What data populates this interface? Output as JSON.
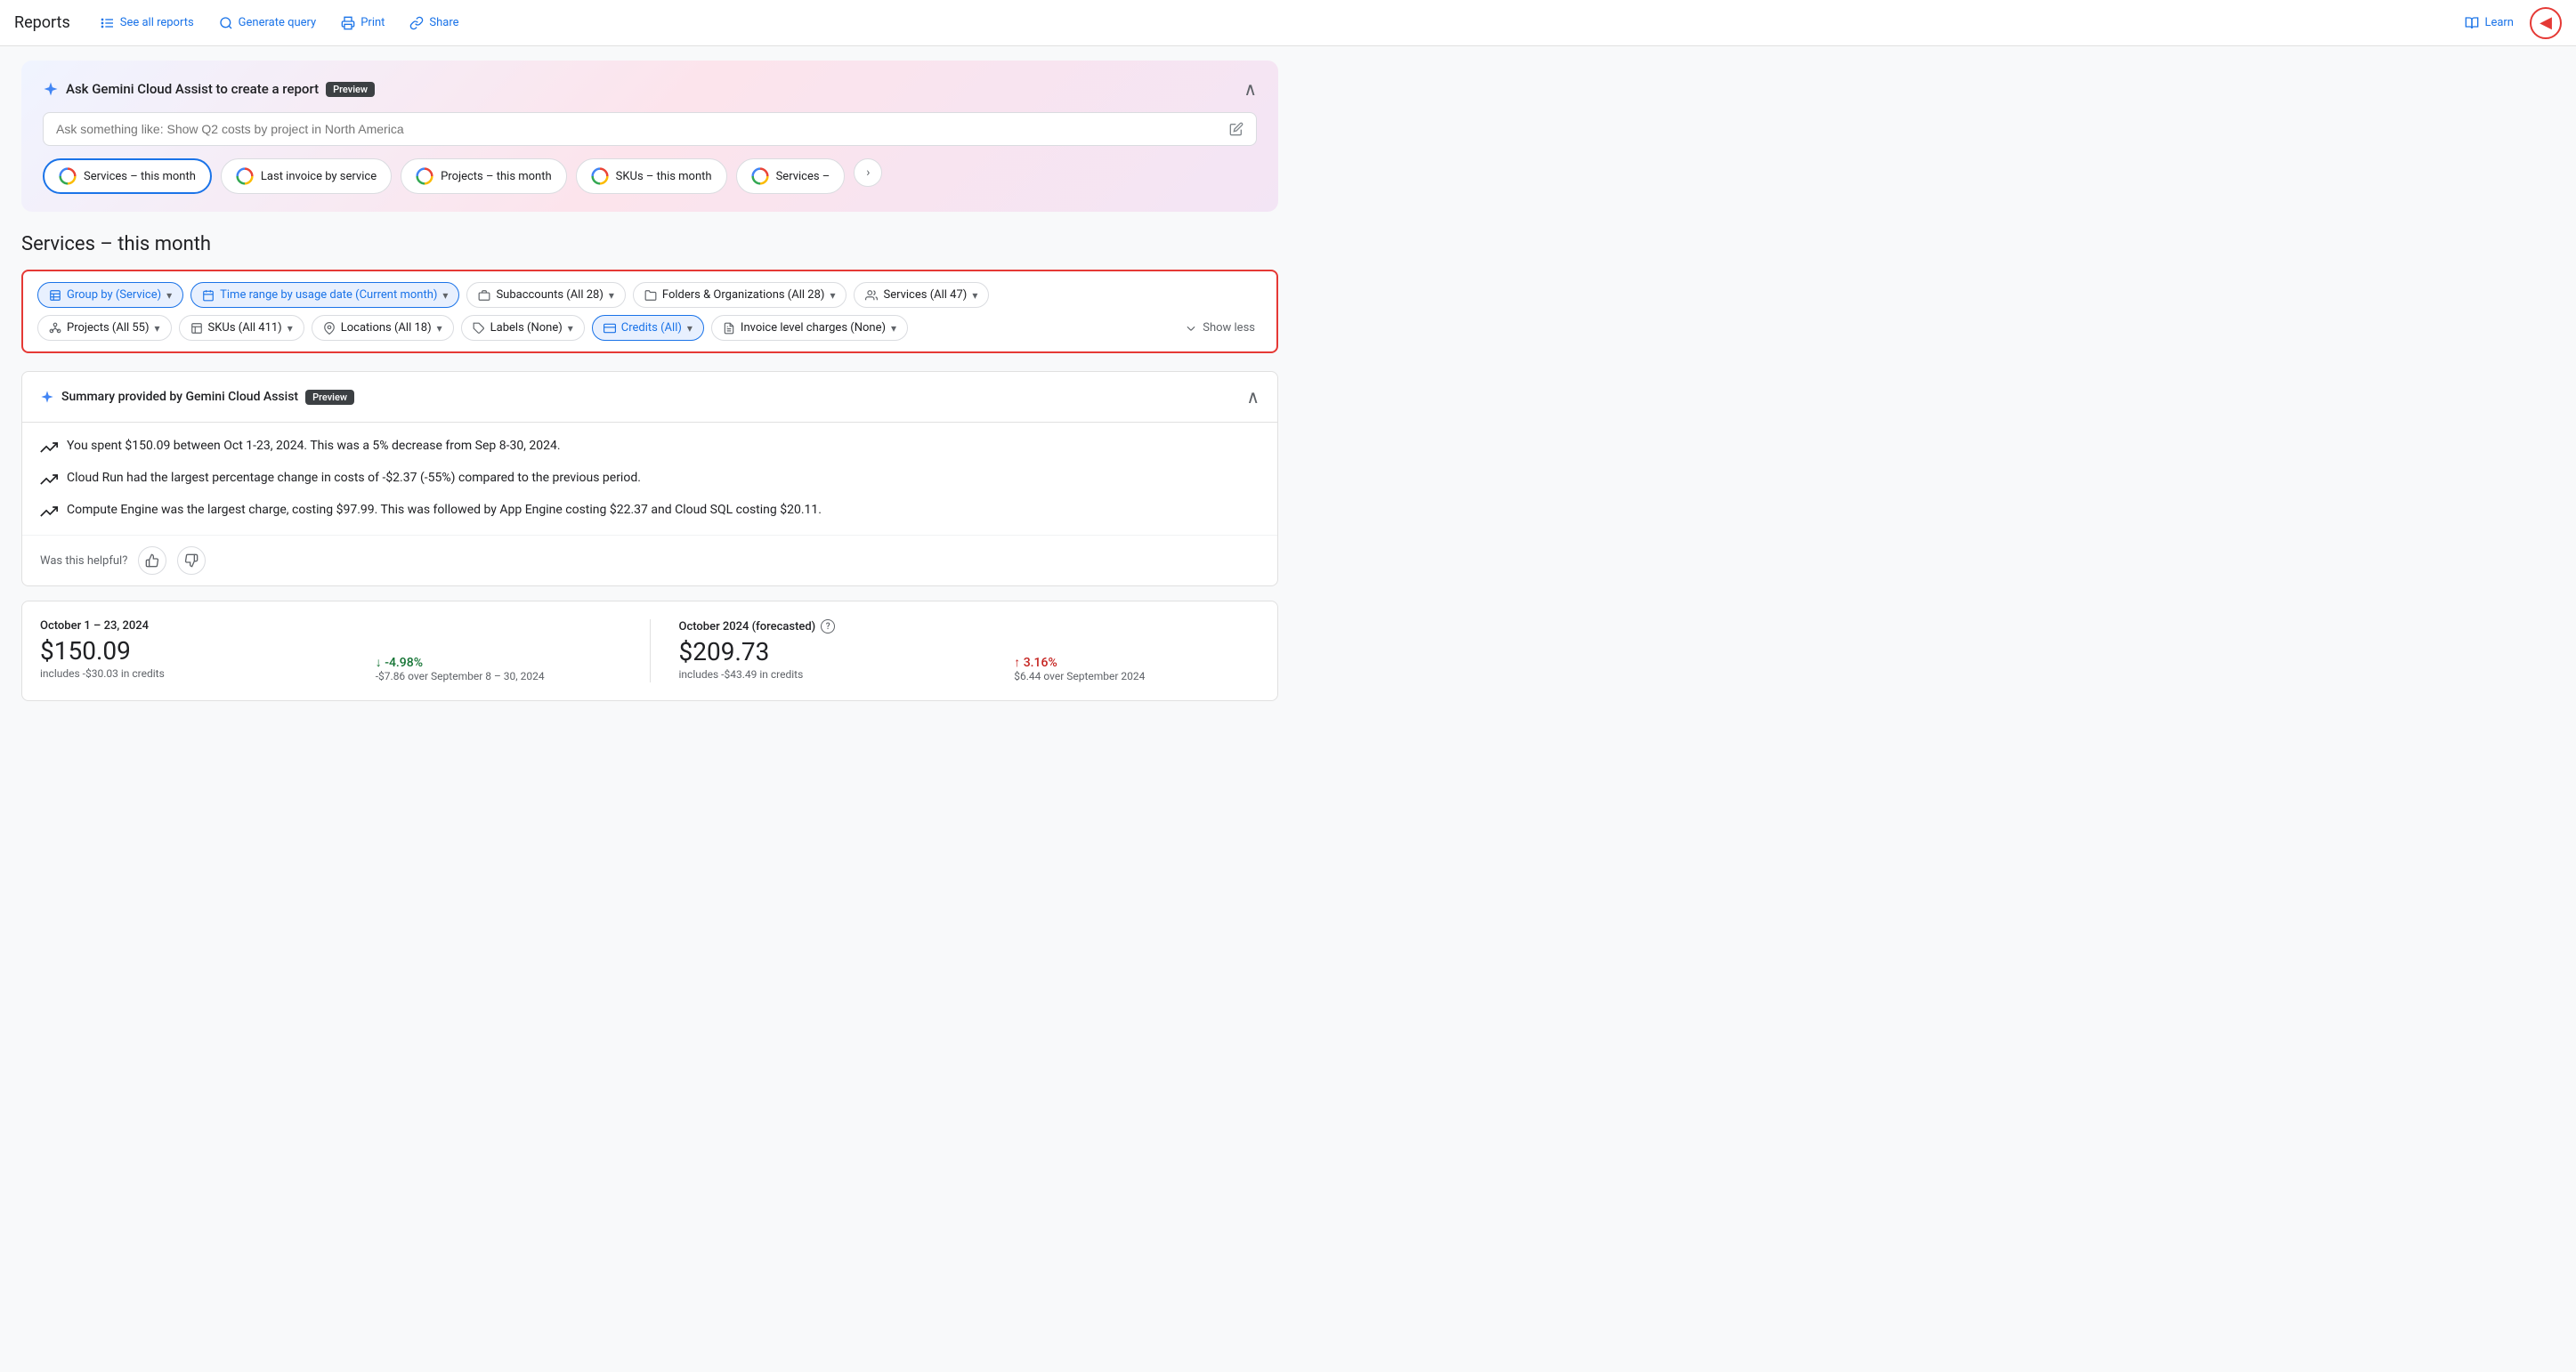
{
  "topnav": {
    "title": "Reports",
    "links": [
      {
        "id": "see-all-reports",
        "label": "See all reports",
        "icon": "list"
      },
      {
        "id": "generate-query",
        "label": "Generate query",
        "icon": "search"
      },
      {
        "id": "print",
        "label": "Print",
        "icon": "print"
      },
      {
        "id": "share",
        "label": "Share",
        "icon": "link"
      }
    ],
    "learn_label": "Learn",
    "panel_icon": "◀"
  },
  "gemini": {
    "title": "Ask Gemini Cloud Assist to create a report",
    "badge": "Preview",
    "placeholder": "Ask something like: Show Q2 costs by project in North America",
    "chips": [
      {
        "id": "chip-services",
        "label": "Services – this month",
        "active": true
      },
      {
        "id": "chip-invoice",
        "label": "Last invoice by service",
        "active": false
      },
      {
        "id": "chip-projects",
        "label": "Projects – this month",
        "active": false
      },
      {
        "id": "chip-skus",
        "label": "SKUs – this month",
        "active": false
      },
      {
        "id": "chip-services2",
        "label": "Services –",
        "active": false
      }
    ]
  },
  "page": {
    "title": "Services – this month"
  },
  "filters": {
    "row1": [
      {
        "id": "group-by",
        "label": "Group by (Service)",
        "highlighted": true
      },
      {
        "id": "time-range",
        "label": "Time range by usage date (Current month)",
        "highlighted": true
      },
      {
        "id": "subaccounts",
        "label": "Subaccounts (All 28)",
        "highlighted": false
      },
      {
        "id": "folders",
        "label": "Folders & Organizations (All 28)",
        "highlighted": false
      },
      {
        "id": "services",
        "label": "Services (All 47)",
        "highlighted": false
      }
    ],
    "row2": [
      {
        "id": "projects",
        "label": "Projects (All 55)",
        "highlighted": false
      },
      {
        "id": "skus",
        "label": "SKUs (All 411)",
        "highlighted": false
      },
      {
        "id": "locations",
        "label": "Locations (All 18)",
        "highlighted": false
      },
      {
        "id": "labels",
        "label": "Labels (None)",
        "highlighted": false
      },
      {
        "id": "credits",
        "label": "Credits (All)",
        "highlighted": true
      },
      {
        "id": "invoice-charges",
        "label": "Invoice level charges (None)",
        "highlighted": false
      }
    ],
    "show_less": "Show less"
  },
  "summary": {
    "title": "Summary provided by Gemini Cloud Assist",
    "badge": "Preview",
    "items": [
      {
        "id": "summary-1",
        "text": "You spent $150.09 between Oct 1-23, 2024. This was a 5% decrease from Sep 8-30, 2024."
      },
      {
        "id": "summary-2",
        "text": "Cloud Run had the largest percentage change in costs of -$2.37 (-55%) compared to the previous period."
      },
      {
        "id": "summary-3",
        "text": "Compute Engine was the largest charge, costing $97.99. This was followed by App Engine costing $22.37 and Cloud SQL costing $20.11."
      }
    ],
    "helpful_label": "Was this helpful?"
  },
  "stats": {
    "current": {
      "period": "October 1 – 23, 2024",
      "amount": "$150.09",
      "sub": "includes -$30.03 in credits",
      "change": "↓ -4.98%",
      "change_type": "down",
      "change_sub": "-$7.86 over September 8 – 30, 2024"
    },
    "forecast": {
      "period": "October 2024 (forecasted)",
      "amount": "$209.73",
      "sub": "includes -$43.49 in credits",
      "change": "↑ 3.16%",
      "change_type": "up",
      "change_sub": "$6.44 over September 2024"
    }
  }
}
